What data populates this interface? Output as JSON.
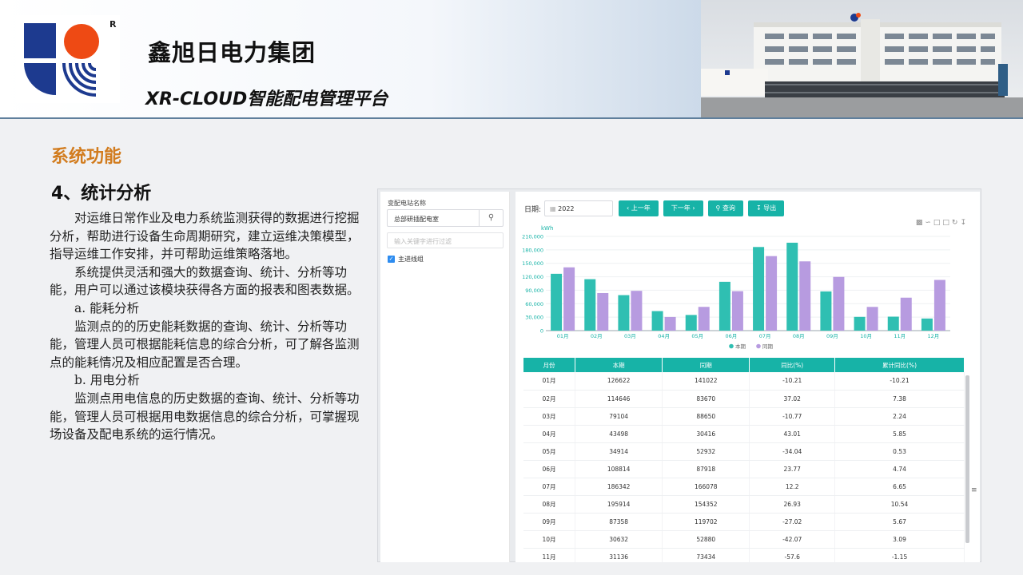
{
  "header": {
    "brand": "鑫旭日电力集团",
    "subtitle": "XR-CLOUD智能配电管理平台",
    "reg_mark": "R"
  },
  "section": {
    "title": "系统功能",
    "subtitle": "4、统计分析"
  },
  "body": {
    "paragraphs": [
      "对运维日常作业及电力系统监测获得的数据进行挖掘分析，帮助进行设备生命周期研究，建立运维决策模型，指导运维工作安排，并可帮助运维策略落地。",
      "系统提供灵活和强大的数据查询、统计、分析等功能，用户可以通过该模块获得各方面的报表和图表数据。",
      "a. 能耗分析",
      "监测点的的历史能耗数据的查询、统计、分析等功能，管理人员可根据能耗信息的综合分析，可了解各监测点的能耗情况及相应配置是否合理。",
      "b. 用电分析",
      "监测点用电信息的历史数据的查询、统计、分析等功能，管理人员可根据用电数据信息的综合分析，可掌握现场设备及配电系统的运行情况。"
    ]
  },
  "app": {
    "left": {
      "label": "变配电站名称",
      "selected": "总部研插配电室",
      "filter_placeholder": "输入关键字进行过滤",
      "tree_item": "主进线组"
    },
    "toolbar": {
      "date_label": "日期:",
      "date_value": "2022",
      "prev": "‹ 上一年",
      "next": "下一年 ›",
      "query": "查询",
      "export": "导出"
    },
    "tool_icons": [
      "bar-chart-icon",
      "line-chart-icon",
      "restore-icon",
      "crop-icon",
      "refresh-icon",
      "download-icon"
    ],
    "colors": {
      "accent": "#17b3a7",
      "current": "#2fbfb2",
      "previous": "#b79be0"
    }
  },
  "chart_data": {
    "type": "bar",
    "ylabel": "kWh",
    "ylim": [
      0,
      210000
    ],
    "yticks": [
      "0",
      "30,000",
      "60,000",
      "90,000",
      "120,000",
      "150,000",
      "180,000",
      "210,000"
    ],
    "categories": [
      "01月",
      "02月",
      "03月",
      "04月",
      "05月",
      "06月",
      "07月",
      "08月",
      "09月",
      "10月",
      "11月",
      "12月"
    ],
    "series": [
      {
        "name": "本期",
        "values": [
          126622,
          114646,
          79104,
          43498,
          34914,
          108814,
          186342,
          195914,
          87358,
          30632,
          31136,
          27000
        ]
      },
      {
        "name": "同期",
        "values": [
          141022,
          83670,
          88650,
          30416,
          52932,
          87918,
          166078,
          154352,
          119702,
          52880,
          73434,
          113000
        ]
      }
    ]
  },
  "table": {
    "headers": [
      "月份",
      "本期",
      "同期",
      "同比(%)",
      "累计同比(%)"
    ],
    "rows": [
      [
        "01月",
        "126622",
        "141022",
        "-10.21",
        "-10.21"
      ],
      [
        "02月",
        "114646",
        "83670",
        "37.02",
        "7.38"
      ],
      [
        "03月",
        "79104",
        "88650",
        "-10.77",
        "2.24"
      ],
      [
        "04月",
        "43498",
        "30416",
        "43.01",
        "5.85"
      ],
      [
        "05月",
        "34914",
        "52932",
        "-34.04",
        "0.53"
      ],
      [
        "06月",
        "108814",
        "87918",
        "23.77",
        "4.74"
      ],
      [
        "07月",
        "186342",
        "166078",
        "12.2",
        "6.65"
      ],
      [
        "08月",
        "195914",
        "154352",
        "26.93",
        "10.54"
      ],
      [
        "09月",
        "87358",
        "119702",
        "-27.02",
        "5.67"
      ],
      [
        "10月",
        "30632",
        "52880",
        "-42.07",
        "3.09"
      ],
      [
        "11月",
        "31136",
        "73434",
        "-57.6",
        "-1.15"
      ]
    ]
  }
}
